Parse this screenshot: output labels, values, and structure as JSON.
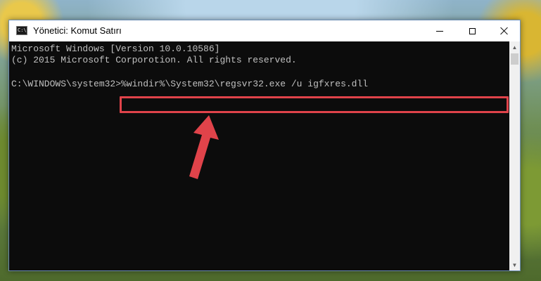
{
  "window": {
    "title": "Yönetici: Komut Satırı",
    "icon_label": "C:\\"
  },
  "console": {
    "line1": "Microsoft Windows [Version 10.0.10586]",
    "line2": "(c) 2015 Microsoft Corporotion. All rights reserved.",
    "prompt": "C:\\WINDOWS\\system32>",
    "command": "%windir%\\System32\\regsvr32.exe /u igfxres.dll"
  },
  "icons": {
    "minimize": "minimize-icon",
    "maximize": "maximize-icon",
    "close": "close-icon",
    "app": "cmd-icon",
    "annotation": "red-arrow"
  },
  "colors": {
    "console_bg": "#0c0c0c",
    "console_text": "#c0c0c0",
    "highlight": "#e0434a"
  }
}
